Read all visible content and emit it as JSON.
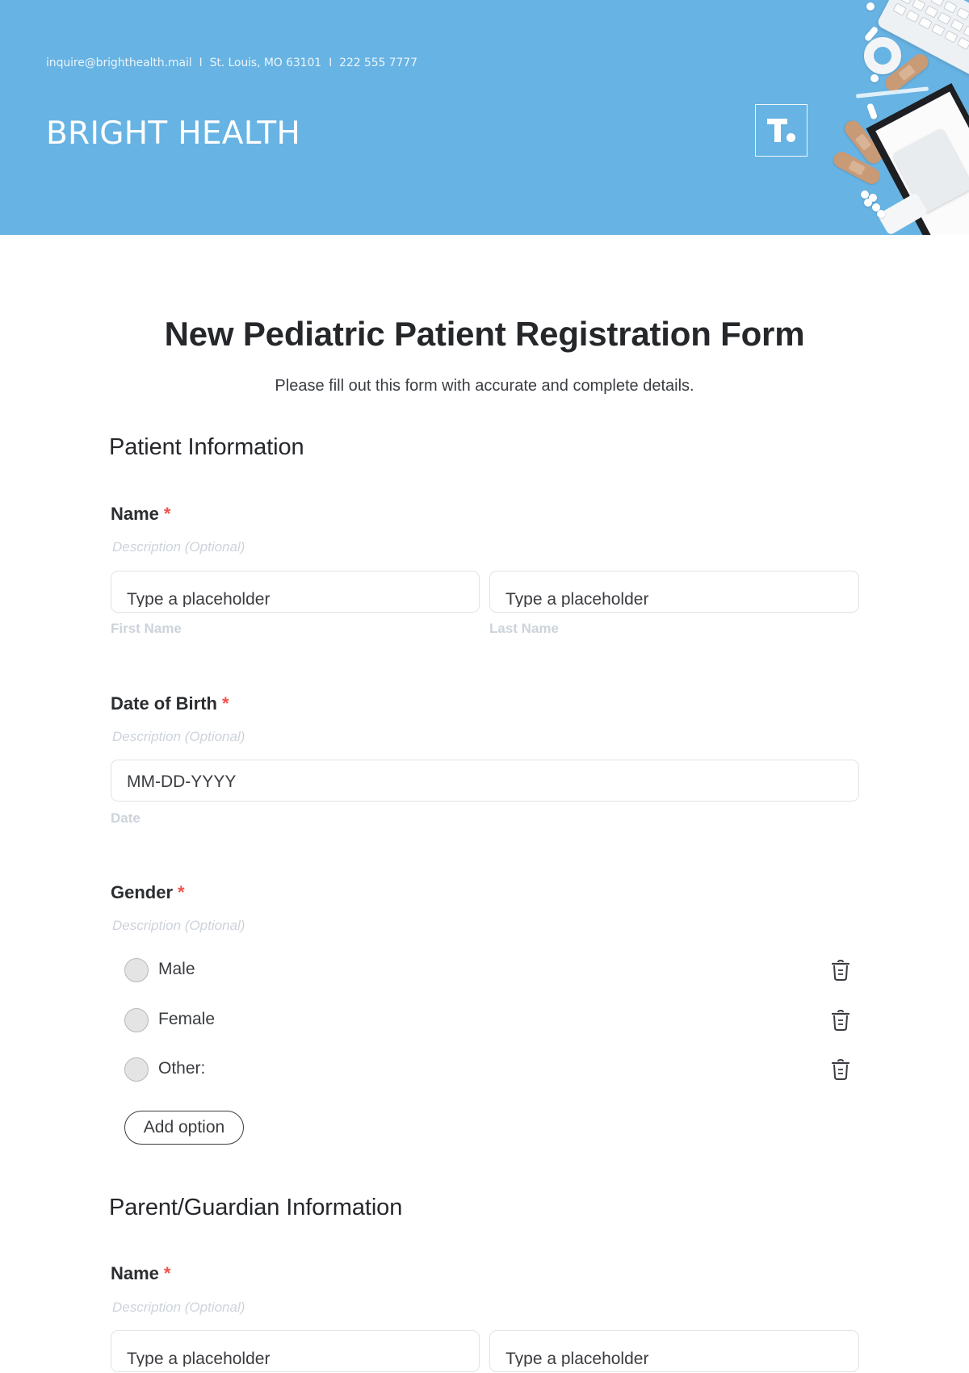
{
  "header": {
    "contact": {
      "email": "inquire@brighthealth.mail",
      "address": "St. Louis, MO 63101",
      "phone": "222 555 7777",
      "separator": "I"
    },
    "brand_name": "BRIGHT HEALTH",
    "logo_text": "T.",
    "colors": {
      "banner": "#67b3e3",
      "brand_text": "#ffffff"
    }
  },
  "form": {
    "title": "New Pediatric Patient Registration Form",
    "subtitle": "Please fill out this form with accurate and complete details.",
    "required_marker": "*",
    "required_color": "#f0524a",
    "sections": [
      {
        "title": "Patient Information",
        "fields": [
          {
            "label": "Name",
            "required": true,
            "description": "Description (Optional)",
            "inputs": [
              {
                "placeholder": "Type a placeholder",
                "sublabel": "First Name"
              },
              {
                "placeholder": "Type a placeholder",
                "sublabel": "Last Name"
              }
            ]
          },
          {
            "label": "Date of Birth",
            "required": true,
            "description": "Description (Optional)",
            "inputs": [
              {
                "placeholder": "MM-DD-YYYY",
                "sublabel": "Date"
              }
            ]
          },
          {
            "label": "Gender",
            "required": true,
            "description": "Description (Optional)",
            "options": [
              {
                "label": "Male",
                "selected": false
              },
              {
                "label": "Female",
                "selected": false
              },
              {
                "label": "Other:",
                "selected": false
              }
            ],
            "add_option_label": "Add option"
          }
        ]
      },
      {
        "title": "Parent/Guardian Information",
        "fields": [
          {
            "label": "Name",
            "required": true,
            "description": "Description (Optional)",
            "inputs": [
              {
                "placeholder": "Type a placeholder"
              },
              {
                "placeholder": "Type a placeholder"
              }
            ]
          }
        ]
      }
    ]
  }
}
